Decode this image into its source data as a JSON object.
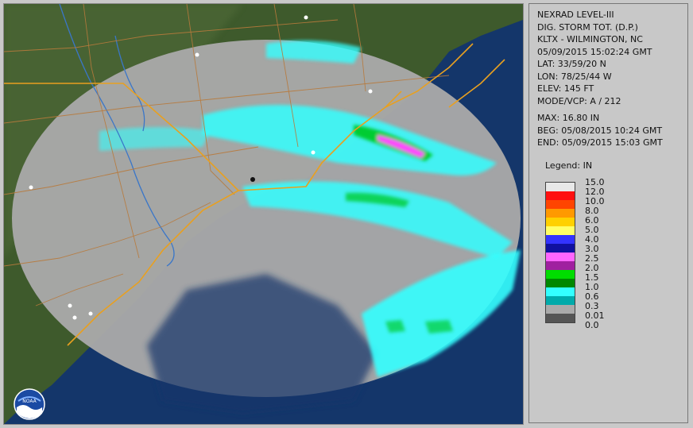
{
  "header": {
    "lines": [
      "NEXRAD LEVEL-III",
      "DIG. STORM TOT. (D.P.)",
      "KLTX - WILMINGTON, NC",
      "05/09/2015 15:02:24 GMT",
      "LAT: 33/59/20 N",
      "LON: 78/25/44 W",
      "ELEV: 145 FT",
      "MODE/VCP: A / 212"
    ]
  },
  "stats": {
    "lines": [
      "MAX: 16.80 IN",
      "BEG: 05/08/2015 10:24 GMT",
      "END: 05/09/2015 15:03 GMT"
    ]
  },
  "legend": {
    "title": "Legend: IN",
    "labels": [
      "15.0",
      "12.0",
      "10.0",
      "8.0",
      "6.0",
      "5.0",
      "4.0",
      "3.0",
      "2.5",
      "2.0",
      "1.5",
      "1.0",
      "0.6",
      "0.3",
      "0.01",
      "0.0"
    ],
    "colors": [
      "#e8e8e8",
      "#ff1010",
      "#ff4400",
      "#ff9900",
      "#ffd000",
      "#ffff66",
      "#3333ff",
      "#1010a0",
      "#ff66ff",
      "#a020a0",
      "#00dd00",
      "#008800",
      "#33ffff",
      "#00aaaa",
      "#aaaaaa",
      "#555555"
    ]
  },
  "logo": {
    "text": "NOAA"
  },
  "colors": {
    "ocean": "#14366a",
    "land": "#3e5a2c",
    "precip_base": "#a8a8a8",
    "roads": "#e8a020",
    "borders": "#b87a3c",
    "rivers": "#3a76c8"
  }
}
